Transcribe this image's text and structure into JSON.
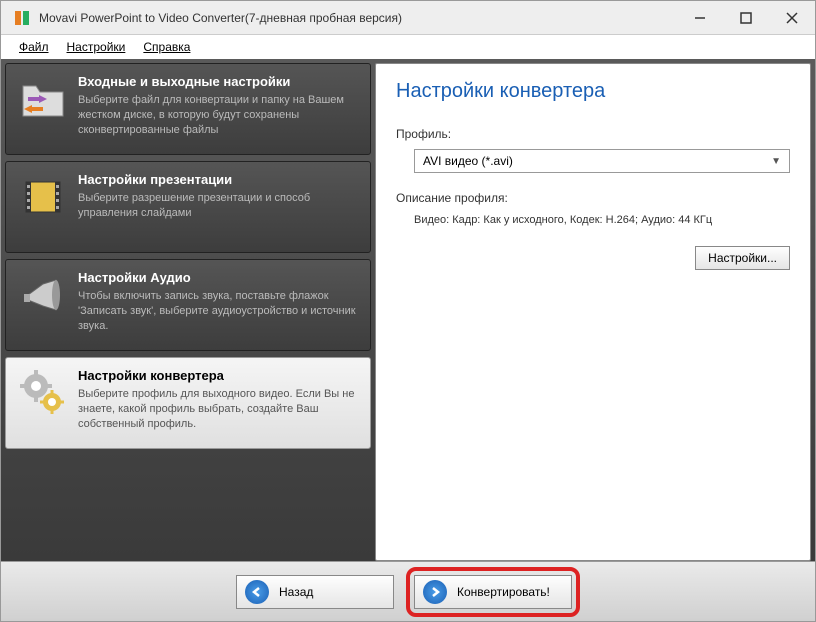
{
  "window": {
    "title": "Movavi PowerPoint to Video Converter(7-дневная пробная версия)"
  },
  "menu": {
    "file": "Файл",
    "settings": "Настройки",
    "help": "Справка"
  },
  "nav": {
    "io": {
      "title": "Входные и выходные настройки",
      "desc": "Выберите файл для конвертации и папку на Вашем жестком диске, в которую будут сохранены сконвертированные файлы"
    },
    "presentation": {
      "title": "Настройки презентации",
      "desc": "Выберите разрешение презентации и способ управления слайдами"
    },
    "audio": {
      "title": "Настройки Аудио",
      "desc": "Чтобы включить запись звука, поставьте флажок 'Записать звук', выберите аудиоустройство и источник звука."
    },
    "converter": {
      "title": "Настройки конвертера",
      "desc": "Выберите профиль для выходного видео. Если Вы не знаете, какой профиль выбрать, создайте Ваш собственный профиль."
    }
  },
  "panel": {
    "title": "Настройки конвертера",
    "profile_label": "Профиль:",
    "profile_value": "AVI видео (*.avi)",
    "desc_label": "Описание профиля:",
    "desc_text": "Видео: Кадр: Как у исходного, Кодек: H.264; Аудио: 44 КГц",
    "settings_btn": "Настройки..."
  },
  "footer": {
    "back": "Назад",
    "convert": "Конвертировать!"
  }
}
